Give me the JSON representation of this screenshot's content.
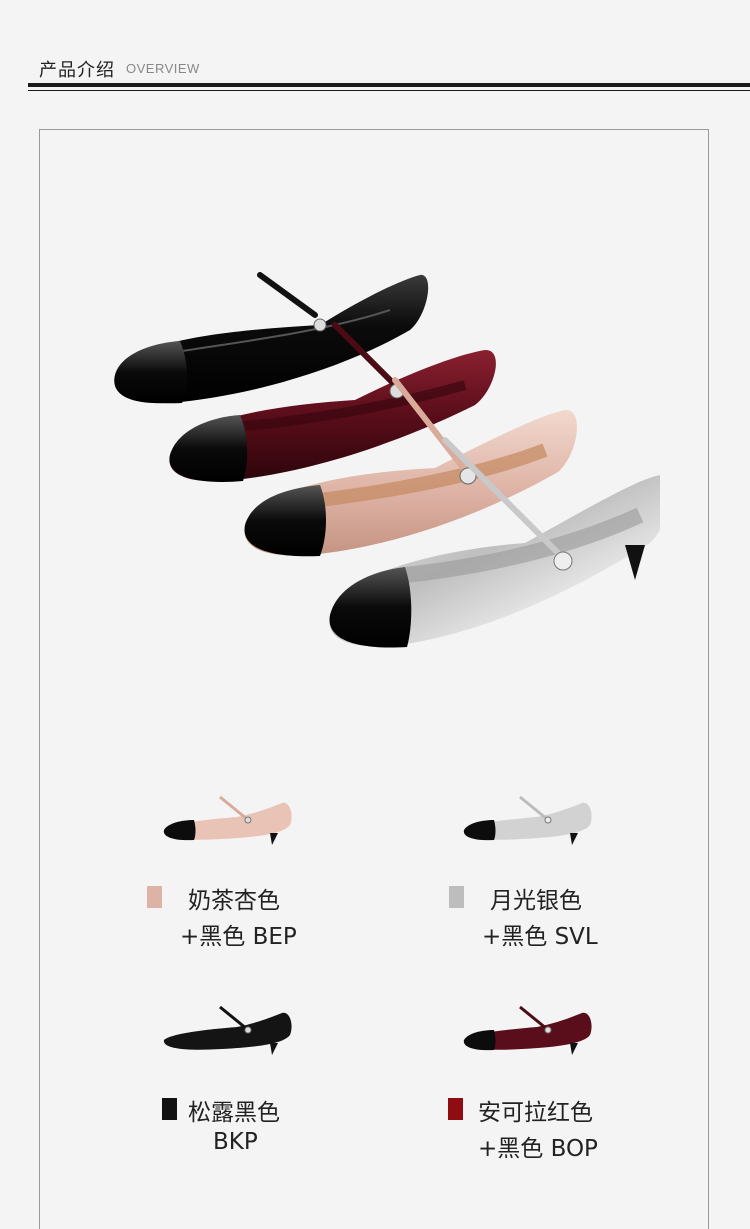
{
  "header": {
    "title": "产品介绍",
    "subtitle": "OVERVIEW"
  },
  "variants": [
    {
      "name": "奶茶杏色",
      "code": "+黑色 BEP",
      "swatch_color": "#dcb3a6",
      "shoe_color": "#e8c3b6",
      "icon": "beige-shoe-icon"
    },
    {
      "name": "月光银色",
      "code": "+黑色 SVL",
      "swatch_color": "#bdbdbd",
      "shoe_color": "#d2d2d2",
      "icon": "silver-shoe-icon"
    },
    {
      "name": "松露黑色",
      "code": "BKP",
      "swatch_color": "#111111",
      "shoe_color": "#141414",
      "icon": "black-shoe-icon"
    },
    {
      "name": "安可拉红色",
      "code": "+黑色 BOP",
      "swatch_color": "#8e0c12",
      "shoe_color": "#5a0d1a",
      "icon": "burgundy-shoe-icon"
    }
  ]
}
